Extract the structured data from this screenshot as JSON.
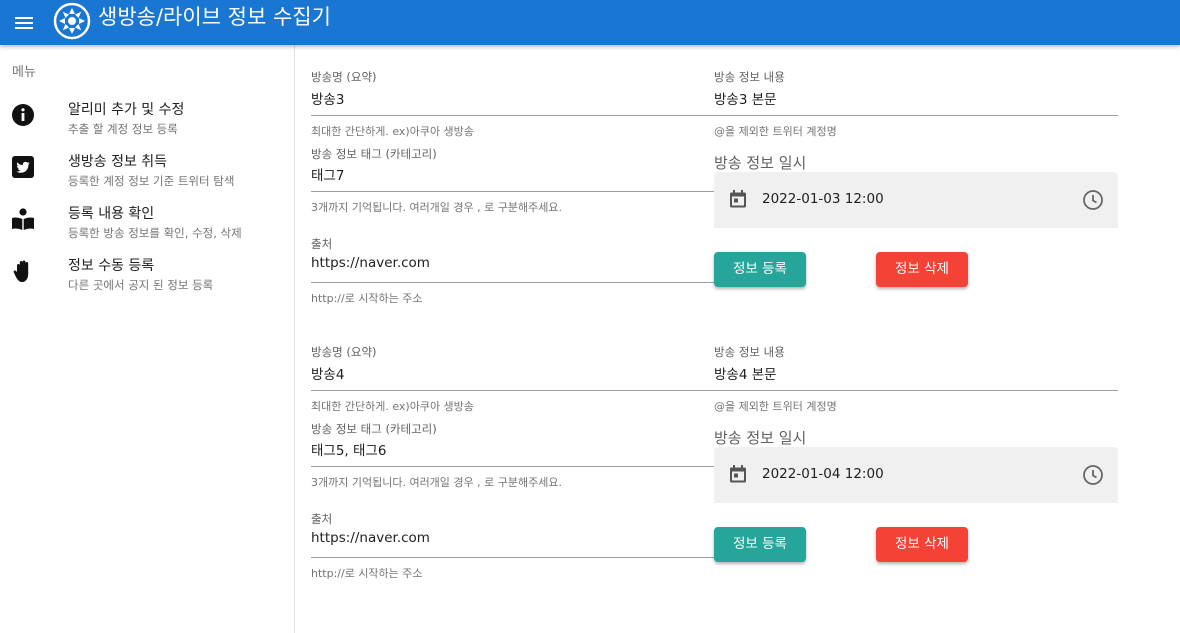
{
  "app": {
    "title": "생방송/라이브 정보 수집기"
  },
  "sidebar": {
    "header": "메뉴",
    "items": [
      {
        "title": "알리미 추가 및 수정",
        "subtitle": "추출 할 계정 정보 등록",
        "icon": "info-icon"
      },
      {
        "title": "생방송 정보 취득",
        "subtitle": "등록한 계정 정보 기준 트위터 탐색",
        "icon": "twitter-icon"
      },
      {
        "title": "등록 내용 확인",
        "subtitle": "등록한 방송 정보를 확인, 수정, 삭제",
        "icon": "book-reader-icon"
      },
      {
        "title": "정보 수동 등록",
        "subtitle": "다른 곳에서 공지 된 정보 등록",
        "icon": "hand-icon"
      }
    ]
  },
  "entries": [
    {
      "name_label": "방송명 (요약)",
      "name_value": "방송3",
      "name_hint": "최대한 간단하게. ex)아쿠아 생방송",
      "content_label": "방송 정보 내용",
      "content_value": "방송3 본문",
      "content_hint": "@을 제외한 트위터 계정명",
      "tag_label": "방송 정보 태그 (카테고리)",
      "tag_value": "태그7",
      "tag_hint": "3개까지 기억됩니다. 여러개일 경우 , 로 구분해주세요.",
      "datetime_label": "방송 정보 일시",
      "datetime_value": "2022-01-03 12:00",
      "source_label": "출처",
      "source_value": "https://naver.com",
      "source_hint": "http://로 시작하는 주소",
      "register_button": "정보 등록",
      "delete_button": "정보 삭제"
    },
    {
      "name_label": "방송명 (요약)",
      "name_value": "방송4",
      "name_hint": "최대한 간단하게. ex)아쿠아 생방송",
      "content_label": "방송 정보 내용",
      "content_value": "방송4 본문",
      "content_hint": "@을 제외한 트위터 계정명",
      "tag_label": "방송 정보 태그 (카테고리)",
      "tag_value": "태그5, 태그6",
      "tag_hint": "3개까지 기억됩니다. 여러개일 경우 , 로 구분해주세요.",
      "datetime_label": "방송 정보 일시",
      "datetime_value": "2022-01-04 12:00",
      "source_label": "출처",
      "source_value": "https://naver.com",
      "source_hint": "http://로 시작하는 주소",
      "register_button": "정보 등록",
      "delete_button": "정보 삭제"
    }
  ],
  "colors": {
    "appbar": "#1976d2",
    "register_button": "#26a69a",
    "delete_button": "#f44336"
  }
}
